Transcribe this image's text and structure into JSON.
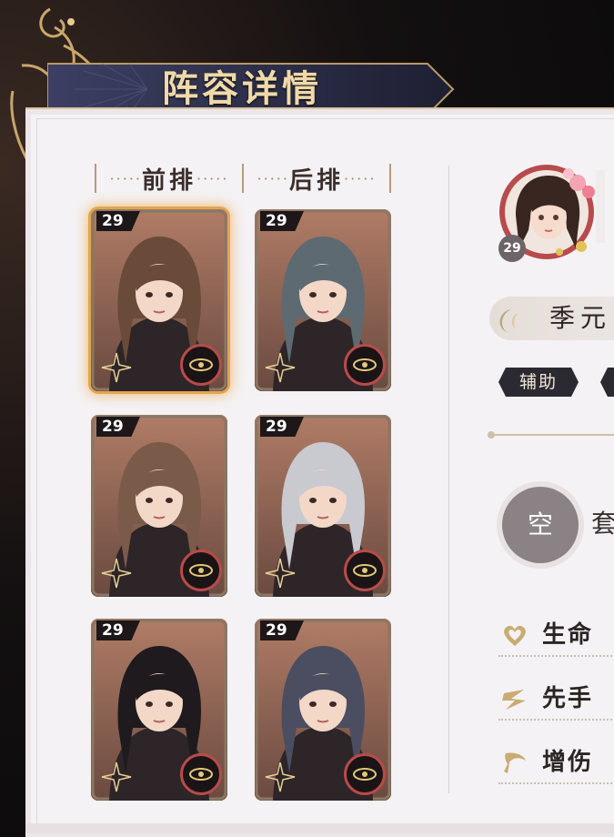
{
  "title": "阵容详情",
  "columns": {
    "front_label": "前排",
    "back_label": "后排"
  },
  "roster": [
    {
      "row": "front",
      "level": "29",
      "selected": true
    },
    {
      "row": "back",
      "level": "29",
      "selected": false
    },
    {
      "row": "front",
      "level": "29",
      "selected": false
    },
    {
      "row": "back",
      "level": "29",
      "selected": false
    },
    {
      "row": "front",
      "level": "29",
      "selected": false
    },
    {
      "row": "back",
      "level": "29",
      "selected": false
    }
  ],
  "detail": {
    "level": "29",
    "name": "季元",
    "role": "辅助",
    "equip_empty": "空",
    "equip_set_label": "套",
    "stats": [
      {
        "label": "生命",
        "icon": "heart-icon"
      },
      {
        "label": "先手",
        "icon": "speed-icon"
      },
      {
        "label": "增伤",
        "icon": "blade-icon"
      }
    ]
  },
  "colors": {
    "panel": "#f4f2f4",
    "title_text": "#efd9a8",
    "selected_glow": "#e2a64e",
    "emblem_ring": "#b84b49"
  }
}
